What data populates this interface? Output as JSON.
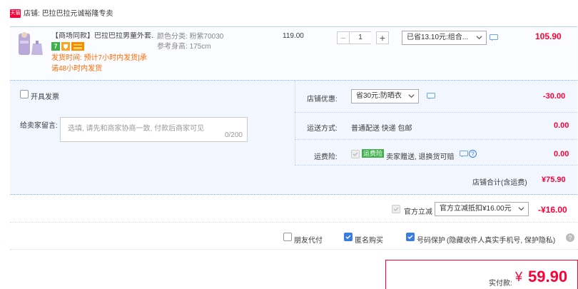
{
  "shop": {
    "badge": "天猫",
    "label": "店铺:",
    "name": "巴拉巴拉元诚裕隆专卖"
  },
  "item": {
    "title": "【商场同款】巴拉巴拉男童外套...",
    "color_label": "颜色分类:",
    "color_value": "粉紫70030",
    "size_label": "参考身高:",
    "size_value": "175cm",
    "ship_note_line1": "发货时间: 预计7小时内发货|承",
    "ship_note_line2": "诺48小时内发货",
    "badge_7": "7",
    "price": "119.00",
    "qty_minus": "−",
    "qty": "1",
    "qty_plus": "+",
    "promo_select": "已省13.10元:组合...",
    "subtotal": "105.90"
  },
  "options": {
    "invoice_label": "开具发票",
    "message_label": "给卖家留言:",
    "message_placeholder": "选填, 请先和商家协商一致, 付款后商家可见",
    "message_counter": "0/200",
    "shop_discount_label": "店铺优惠:",
    "shop_discount_select": "省30元:防晒衣",
    "shop_discount_value": "-30.00",
    "shipping_label": "运送方式:",
    "shipping_value": "普通配送 快递 包邮",
    "shipping_cost": "0.00",
    "insurance_label": "运费险:",
    "insurance_tag": "运费险",
    "insurance_desc": "卖家赠送, 退换货可赔",
    "insurance_cost": "0.00",
    "shop_total_label": "店铺合计(含运费)",
    "shop_total_value": "¥75.90"
  },
  "discount": {
    "label": "官方立减",
    "select": "官方立减抵扣¥16.00元",
    "value": "-¥16.00"
  },
  "extras": {
    "friend_pay": "朋友代付",
    "anonymous": "匿名购买",
    "number_protect": "号码保护",
    "number_protect_desc": "(隐藏收件人真实手机号, 保护隐私)"
  },
  "total": {
    "label": "实付款:",
    "currency": "¥",
    "amount": "59.90"
  },
  "colors": {
    "accent": "#ff0036",
    "orange": "#ff6a00",
    "blue_bg": "#f2f7ff",
    "tag_green": "#3db04a"
  }
}
